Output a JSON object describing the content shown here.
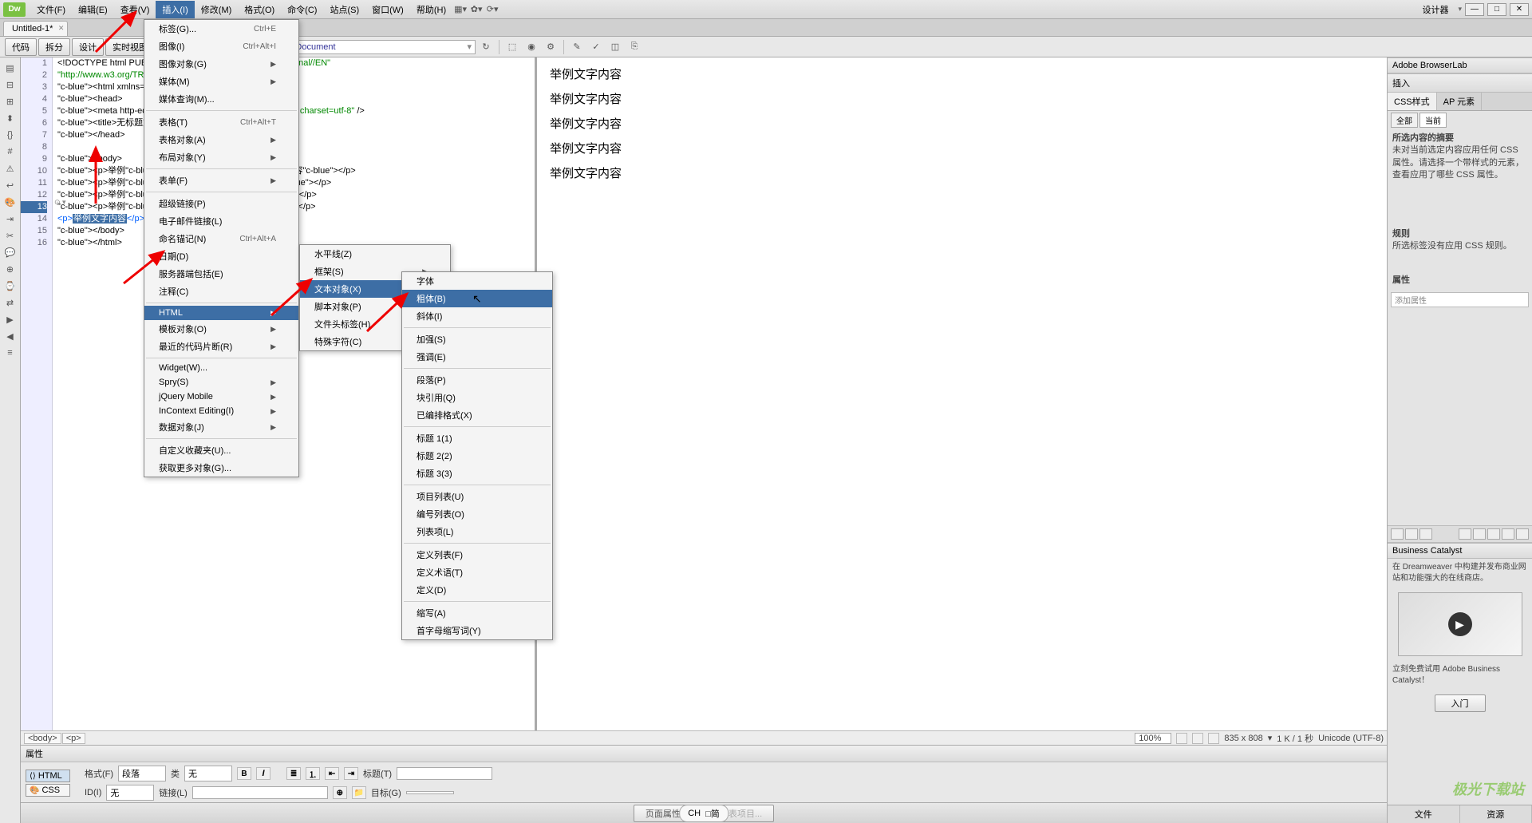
{
  "designer_label": "设计器",
  "menubar": [
    "文件(F)",
    "编辑(E)",
    "查看(V)",
    "插入(I)",
    "修改(M)",
    "格式(O)",
    "命令(C)",
    "站点(S)",
    "窗口(W)",
    "帮助(H)"
  ],
  "active_menu_index": 3,
  "doc_tab": "Untitled-1*",
  "view_modes": [
    "代码",
    "拆分",
    "设计",
    "实时视图"
  ],
  "address": "file:///C|/Unsaved_Document",
  "code": {
    "lines": [
      "<!DOCTYPE html PUBLIC \"-//W3C//DTD XHTML 1.0 Transitional//EN\"",
      "\"http://www.w3.org/TR/xhtml1/DTD/xhtml1-transitional.dtd\">",
      "<html xmlns=\"http://www.w3.org/1999/xhtml\">",
      "<head>",
      "<meta http-equiv=\"Content-Type\" content=\"text/html; charset=utf-8\" />",
      "<title>无标题文档</title>",
      "</head>",
      "",
      "<body>",
      "<p>举例<strong>文字</strong>内容</p>",
      "<p>举例<em>文字</em>内容</p>",
      "<p>举例<u>文字</u>内容</p>",
      "<p>举例<s>文字</s>内容</p>",
      "<p>举例文字内容</p>",
      "</body>",
      "</html>"
    ],
    "selected_line": 13,
    "selected_text": "举例文字内容"
  },
  "preview_lines": [
    "举例文字内容",
    "举例文字内容",
    "举例文字内容",
    "举例文字内容",
    "举例文字内容"
  ],
  "insert_menu": {
    "items": [
      {
        "label": "标签(G)...",
        "shortcut": "Ctrl+E"
      },
      {
        "label": "图像(I)",
        "shortcut": "Ctrl+Alt+I"
      },
      {
        "label": "图像对象(G)",
        "sub": true
      },
      {
        "label": "媒体(M)",
        "sub": true
      },
      {
        "label": "媒体查询(M)..."
      },
      {
        "sep": true
      },
      {
        "label": "表格(T)",
        "shortcut": "Ctrl+Alt+T"
      },
      {
        "label": "表格对象(A)",
        "sub": true
      },
      {
        "label": "布局对象(Y)",
        "sub": true
      },
      {
        "sep": true
      },
      {
        "label": "表单(F)",
        "sub": true
      },
      {
        "sep": true
      },
      {
        "label": "超级链接(P)"
      },
      {
        "label": "电子邮件链接(L)"
      },
      {
        "label": "命名锚记(N)",
        "shortcut": "Ctrl+Alt+A"
      },
      {
        "label": "日期(D)"
      },
      {
        "label": "服务器端包括(E)"
      },
      {
        "label": "注释(C)"
      },
      {
        "sep": true
      },
      {
        "label": "HTML",
        "sub": true,
        "hl": true
      },
      {
        "label": "模板对象(O)",
        "sub": true
      },
      {
        "label": "最近的代码片断(R)",
        "sub": true
      },
      {
        "sep": true
      },
      {
        "label": "Widget(W)..."
      },
      {
        "label": "Spry(S)",
        "sub": true
      },
      {
        "label": "jQuery Mobile",
        "sub": true
      },
      {
        "label": "InContext Editing(I)",
        "sub": true
      },
      {
        "label": "数据对象(J)",
        "sub": true
      },
      {
        "sep": true
      },
      {
        "label": "自定义收藏夹(U)..."
      },
      {
        "label": "获取更多对象(G)..."
      }
    ]
  },
  "html_submenu": [
    {
      "label": "水平线(Z)"
    },
    {
      "label": "框架(S)",
      "sub": true
    },
    {
      "label": "文本对象(X)",
      "sub": true,
      "hl": true
    },
    {
      "label": "脚本对象(P)",
      "sub": true
    },
    {
      "label": "文件头标签(H)",
      "sub": true
    },
    {
      "label": "特殊字符(C)",
      "sub": true
    }
  ],
  "text_submenu": [
    {
      "label": "字体"
    },
    {
      "label": "粗体(B)",
      "hl": true
    },
    {
      "label": "斜体(I)"
    },
    {
      "sep": true
    },
    {
      "label": "加强(S)"
    },
    {
      "label": "强调(E)"
    },
    {
      "sep": true
    },
    {
      "label": "段落(P)"
    },
    {
      "label": "块引用(Q)"
    },
    {
      "label": "已编排格式(X)"
    },
    {
      "sep": true
    },
    {
      "label": "标题 1(1)"
    },
    {
      "label": "标题 2(2)"
    },
    {
      "label": "标题 3(3)"
    },
    {
      "sep": true
    },
    {
      "label": "项目列表(U)"
    },
    {
      "label": "编号列表(O)"
    },
    {
      "label": "列表项(L)"
    },
    {
      "sep": true
    },
    {
      "label": "定义列表(F)"
    },
    {
      "label": "定义术语(T)"
    },
    {
      "label": "定义(D)"
    },
    {
      "sep": true
    },
    {
      "label": "缩写(A)"
    },
    {
      "label": "首字母缩写词(Y)"
    }
  ],
  "tagbar_tags": [
    "<body>",
    "<p>"
  ],
  "status": {
    "zoom": "100%",
    "dims": "835 x 808",
    "size": "1 K / 1 秒",
    "enc": "Unicode (UTF-8)"
  },
  "props": {
    "title": "属性",
    "mode_html": "HTML",
    "mode_css": "CSS",
    "format": "格式(F)",
    "format_val": "段落",
    "class": "类",
    "class_val": "无",
    "id": "ID(I)",
    "id_val": "无",
    "link": "链接(L)",
    "title_f": "标题(T)",
    "target": "目标(G)",
    "page_props": "页面属性...",
    "list_props": "列表项目..."
  },
  "ime": {
    "lang": "CH",
    "mode": "□简"
  },
  "right": {
    "adobe_browserlab": "Adobe BrowserLab",
    "insert": "插入",
    "css_styles": "CSS样式",
    "ap_elements": "AP 元素",
    "all": "全部",
    "current": "当前",
    "sel_summary_title": "所选内容的摘要",
    "sel_summary_text": "未对当前选定内容应用任何 CSS 属性。请选择一个带样式的元素，查看应用了哪些 CSS 属性。",
    "rules": "规则",
    "rules_text": "所选标签没有应用 CSS 规则。",
    "properties": "属性",
    "add_property": "添加属性",
    "bc_title": "Business Catalyst",
    "bc_text": "在 Dreamweaver 中构建并发布商业网站和功能强大的在线商店。",
    "bc_try": "立刻免费试用 Adobe Business Catalyst！",
    "bc_btn": "入门",
    "files": "文件",
    "assets": "资源"
  },
  "watermark": "极光下载站"
}
